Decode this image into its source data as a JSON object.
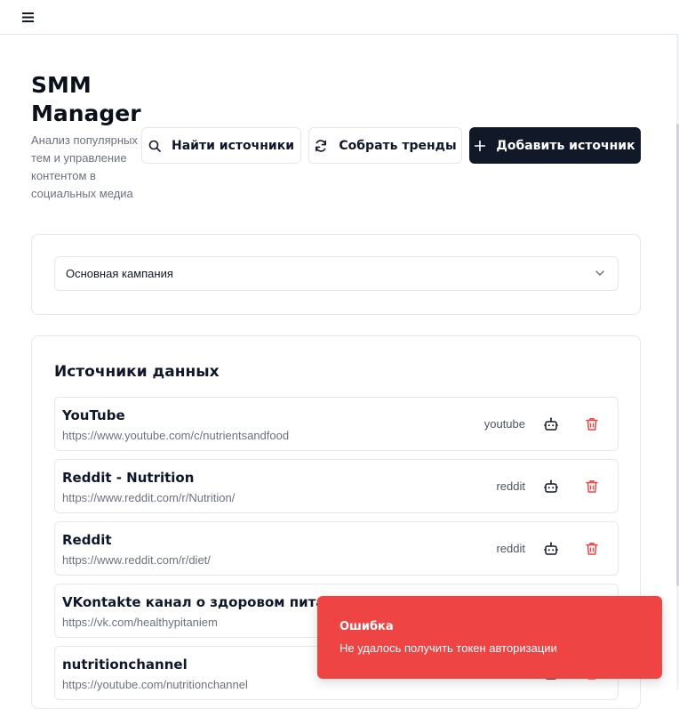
{
  "header": {
    "menu_icon": "hamburger-menu-icon"
  },
  "page": {
    "title": "SMM Manager",
    "subtitle": "Анализ популярных тем и управление контентом в социальных медиа"
  },
  "actions": {
    "find_sources": {
      "label": "Найти источники",
      "icon": "search-icon"
    },
    "collect_trends": {
      "label": "Собрать тренды",
      "icon": "refresh-icon"
    },
    "add_source": {
      "label": "Добавить источник",
      "icon": "plus-icon"
    }
  },
  "campaign_select": {
    "value": "Основная кампания",
    "icon": "chevron-down-icon"
  },
  "sources": {
    "title": "Источники данных",
    "items": [
      {
        "name": "YouTube",
        "url": "https://www.youtube.com/c/nutrientsandfood",
        "type": "youtube"
      },
      {
        "name": "Reddit - Nutrition",
        "url": "https://www.reddit.com/r/Nutrition/",
        "type": "reddit"
      },
      {
        "name": "Reddit",
        "url": "https://www.reddit.com/r/diet/",
        "type": "reddit"
      },
      {
        "name": "VKontakte канал о здоровом питании",
        "url": "https://vk.com/healthypitaniem",
        "type": ""
      },
      {
        "name": "nutritionchannel",
        "url": "https://youtube.com/nutritionchannel",
        "type": ""
      }
    ]
  },
  "toast": {
    "title": "Ошибка",
    "message": "Не удалось получить токен авторизации",
    "color": "#ef4444"
  },
  "colors": {
    "primary": "#111827",
    "danger": "#ef4444",
    "muted": "#6b7280",
    "border": "#e5e7eb"
  }
}
